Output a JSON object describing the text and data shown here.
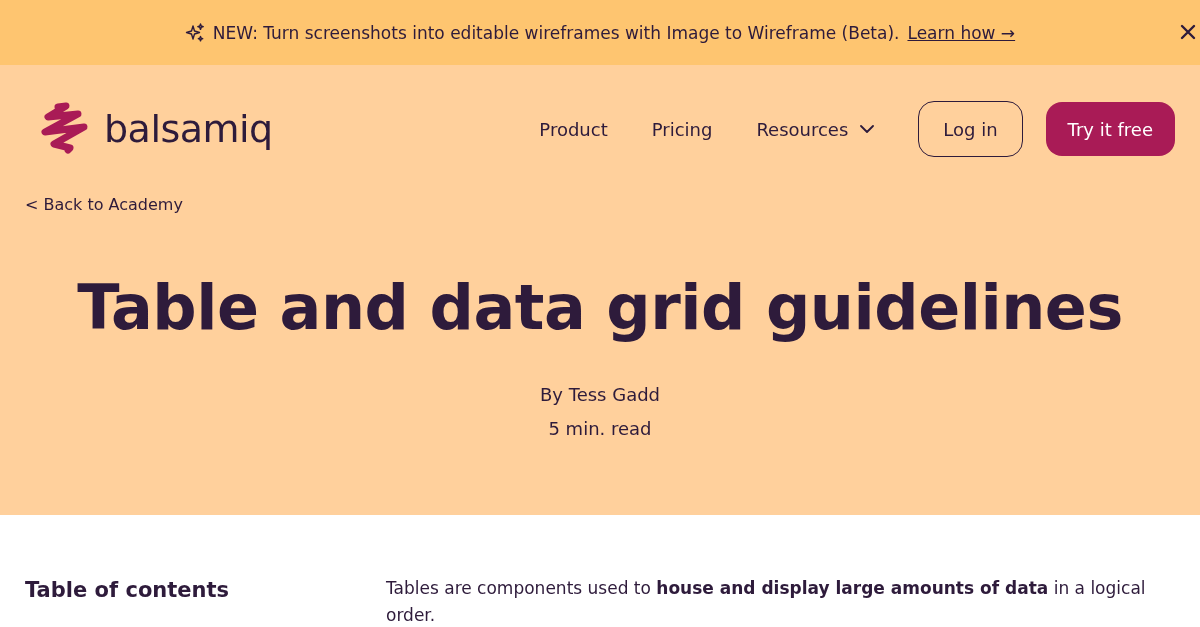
{
  "banner": {
    "text": "NEW: Turn screenshots into editable wireframes with Image to Wireframe (Beta).",
    "link": "Learn how →"
  },
  "header": {
    "logo": "balsamiq",
    "nav": [
      {
        "label": "Product",
        "kind": "link"
      },
      {
        "label": "Pricing",
        "kind": "link"
      },
      {
        "label": "Resources",
        "kind": "dropdown"
      }
    ],
    "actions": [
      {
        "label": "Log in",
        "kind": "outline"
      },
      {
        "label": "Try it free",
        "kind": "primary"
      }
    ]
  },
  "back_link": "< Back to Academy",
  "article": {
    "title": "Table and data grid guidelines",
    "author": "By Tess Gadd",
    "read_time": "5 min. read"
  },
  "toc": {
    "heading": "Table of contents"
  },
  "intro": "Tables are components used to **house and display large amounts of data** in a logical order."
}
